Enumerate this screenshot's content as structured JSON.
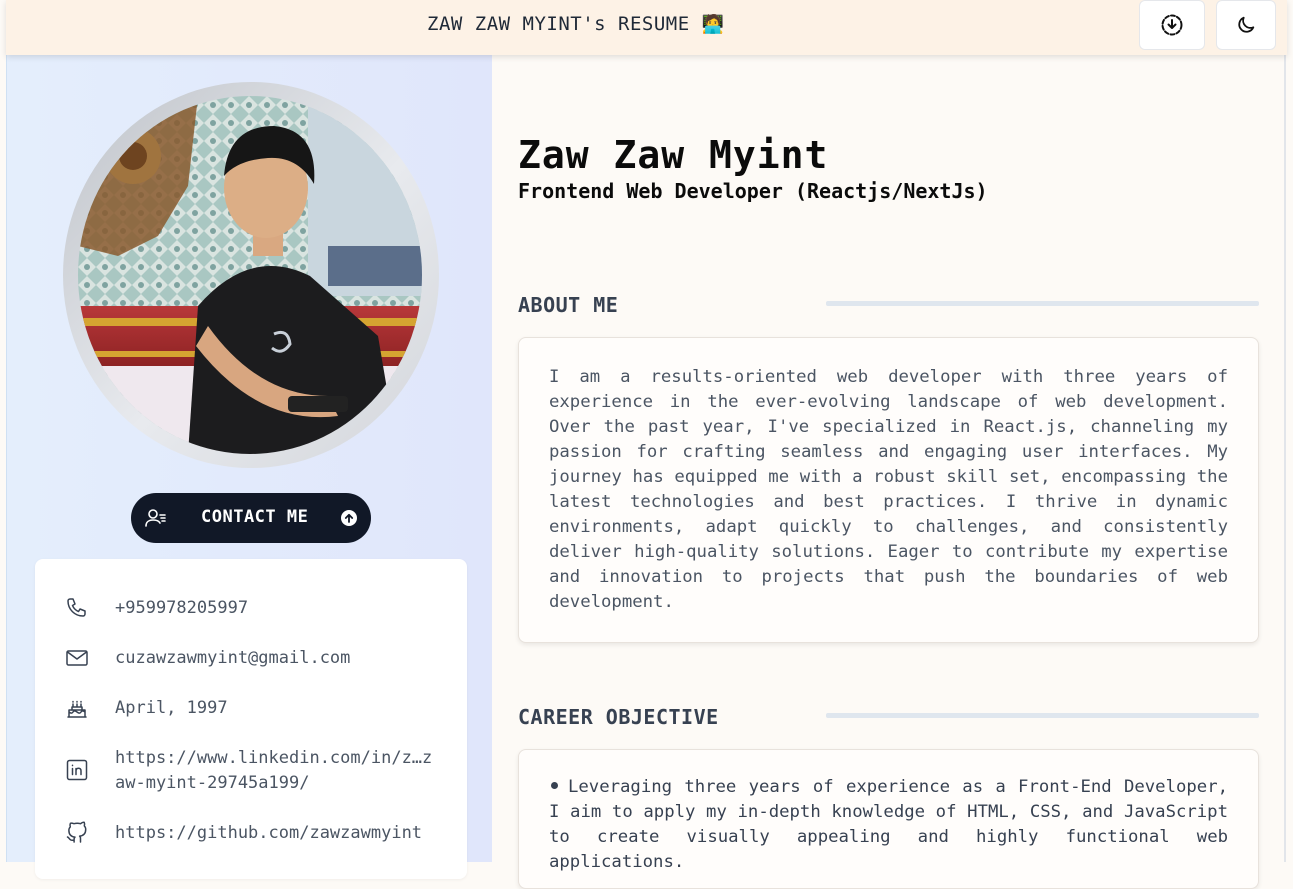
{
  "header": {
    "title": "ZAW ZAW MYINT's RESUME",
    "title_emoji": "🧑‍💻",
    "download_icon": "download-icon",
    "theme_icon": "moon-icon"
  },
  "sidebar": {
    "contact_button": {
      "label": "CONTACT ME",
      "left_icon": "user-list-icon",
      "right_icon": "arrow-up-circle-icon"
    },
    "contact_info": [
      {
        "icon": "phone-icon",
        "text": "+959978205997"
      },
      {
        "icon": "mail-icon",
        "text": "cuzawzawmyint@gmail.com"
      },
      {
        "icon": "cake-icon",
        "text": "April, 1997"
      },
      {
        "icon": "linkedin-icon",
        "text": "https://www.linkedin.com/in/z…zaw-myint-29745a199/"
      },
      {
        "icon": "github-icon",
        "text": "https://github.com/zawzawmyint"
      }
    ]
  },
  "main": {
    "name": "Zaw Zaw Myint",
    "role": "Frontend Web Developer (Reactjs/NextJs)",
    "about": {
      "title": "ABOUT ME",
      "text": "I am a results-oriented web developer with three years of experience in the ever-evolving landscape of web development. Over the past year, I've specialized in React.js, channeling my passion for crafting seamless and engaging user interfaces. My journey has equipped me with a robust skill set, encompassing the latest technologies and best practices. I thrive in dynamic environments, adapt quickly to challenges, and consistently deliver high-quality solutions. Eager to contribute my expertise and innovation to projects that push the boundaries of web development."
    },
    "career": {
      "title": "CAREER OBJECTIVE",
      "items": [
        "Leveraging three years of experience as a Front-End Developer, I aim to apply my in-depth knowledge of HTML, CSS, and JavaScript to create visually appealing and highly functional web applications."
      ]
    }
  },
  "colors": {
    "topbar_bg": "#fdf2e6",
    "sidebar_bg": "#e2eafc",
    "contact_button_bg": "#111827",
    "page_bg": "#fdfaf6"
  }
}
